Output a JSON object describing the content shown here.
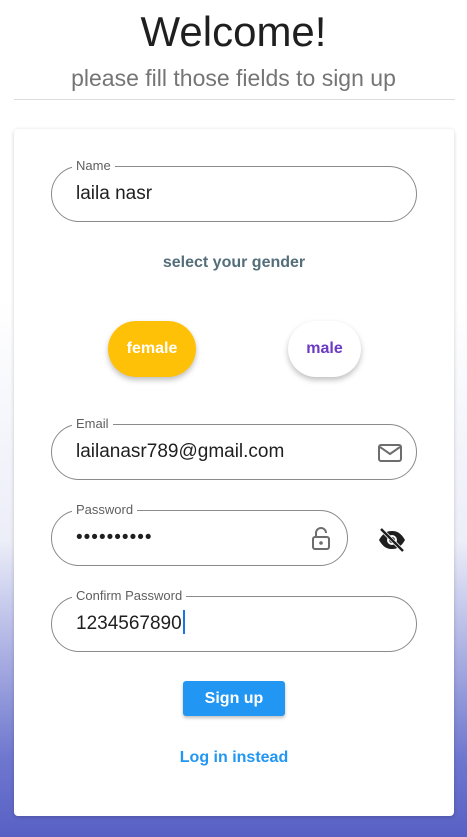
{
  "header": {
    "title": "Welcome!",
    "subtitle": "please fill those fields to sign up"
  },
  "form": {
    "name": {
      "label": "Name",
      "value": "laila nasr"
    },
    "gender": {
      "heading": "select your gender",
      "options": [
        "female",
        "male"
      ],
      "selected": "female"
    },
    "email": {
      "label": "Email",
      "value": "lailanasr789@gmail.com",
      "icon": "mail-icon"
    },
    "password": {
      "label": "Password",
      "value": "••••••••••",
      "icon": "lock-open-icon",
      "toggle_icon": "eye-off-icon"
    },
    "confirm_password": {
      "label": "Confirm Password",
      "value": "1234567890"
    },
    "signup_label": "Sign up",
    "login_label": "Log in instead"
  },
  "colors": {
    "primary": "#2196f3",
    "female_selected": "#ffc107",
    "male_text": "#6a3ac2",
    "heading": "#546e7a"
  }
}
